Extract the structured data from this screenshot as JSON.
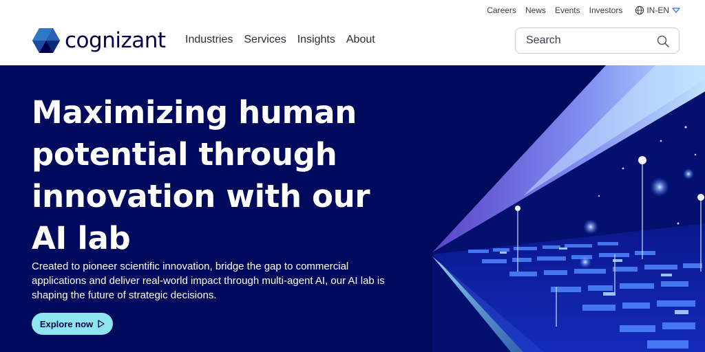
{
  "utility_nav": {
    "links": [
      "Careers",
      "News",
      "Events",
      "Investors"
    ],
    "locale": "IN-EN",
    "globe_icon": "globe-icon",
    "caret_icon": "chevron-down-icon"
  },
  "brand": {
    "name": "cognizant",
    "mark_icon": "cognizant-hexagon-logo",
    "color": "#000048"
  },
  "main_nav": {
    "items": [
      "Industries",
      "Services",
      "Insights",
      "About"
    ]
  },
  "search": {
    "placeholder": "Search",
    "icon": "search-icon"
  },
  "hero": {
    "title": "Maximizing human potential through innovation with our AI lab",
    "description": "Created to pioneer scientific innovation, bridge the gap to commercial applications and deliver real-world impact through multi-agent AI, our AI lab is shaping the future of strategic decisions.",
    "cta_label": "Explore now",
    "cta_icon": "play-outline-icon",
    "background_color": "#000a5c",
    "accent_color": "#8ee5f0"
  }
}
